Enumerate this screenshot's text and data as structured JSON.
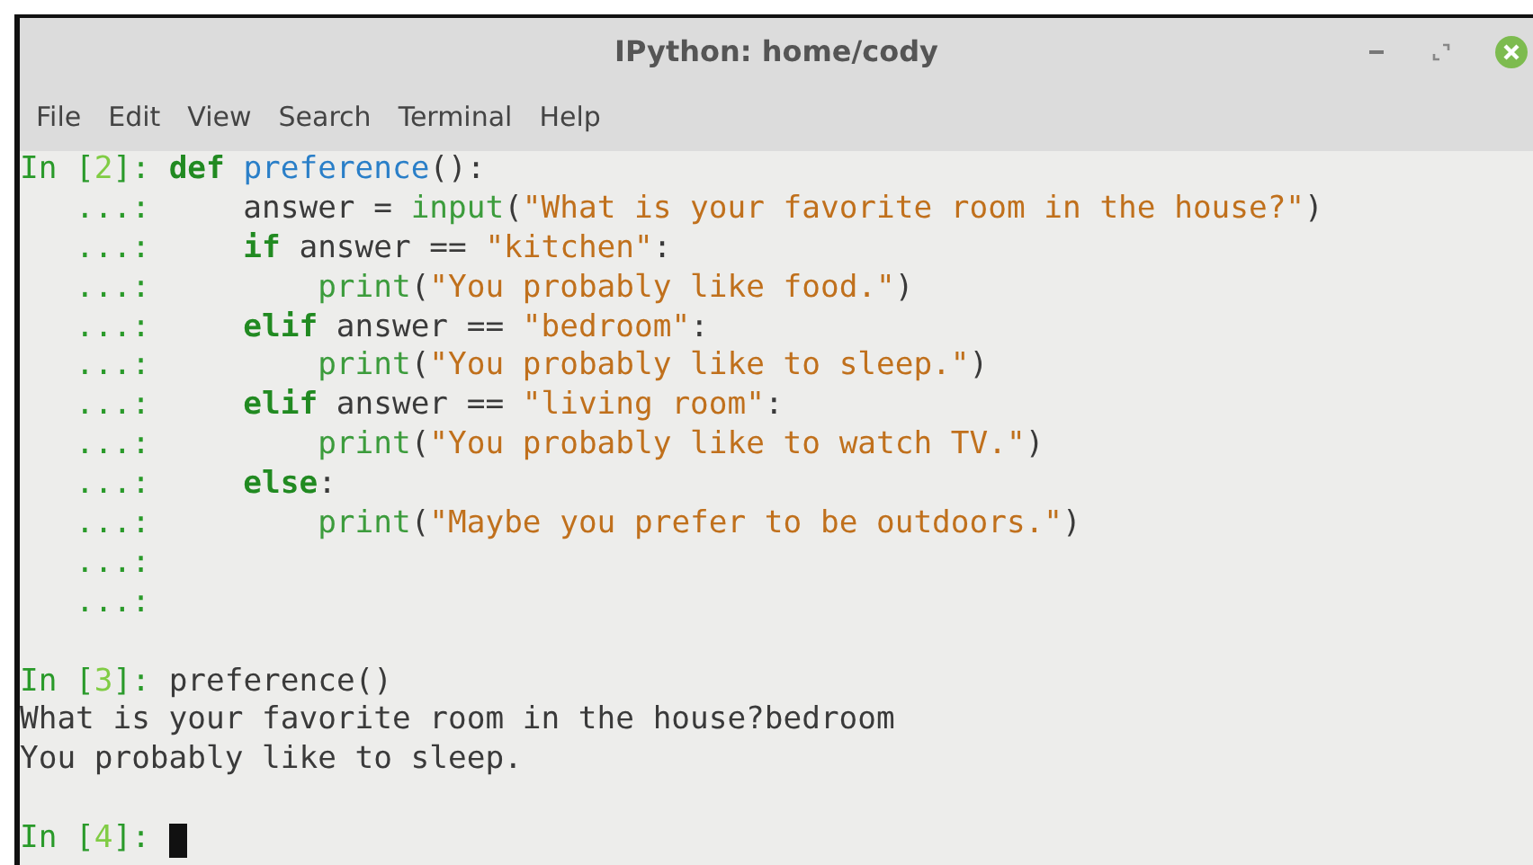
{
  "window": {
    "title": "IPython: home/cody"
  },
  "menu": [
    "File",
    "Edit",
    "View",
    "Search",
    "Terminal",
    "Help"
  ],
  "terminal": {
    "lines": [
      {
        "kind": "input",
        "prompt": [
          {
            "kind": "p",
            "text": "In ["
          },
          {
            "kind": "n",
            "text": "2"
          },
          {
            "kind": "p",
            "text": "]:"
          }
        ],
        "code": [
          {
            "kind": "kw",
            "text": "def"
          },
          {
            "kind": "fn",
            "text": " preference"
          },
          {
            "kind": "x",
            "text": "():"
          }
        ]
      },
      {
        "kind": "input",
        "prompt": [
          {
            "kind": "p",
            "text": "   ...:"
          }
        ],
        "code": [
          {
            "kind": "x",
            "text": "    answer = "
          },
          {
            "kind": "bi",
            "text": "input"
          },
          {
            "kind": "x",
            "text": "("
          },
          {
            "kind": "str",
            "text": "\"What is your favorite room in the house?\""
          },
          {
            "kind": "x",
            "text": ")"
          }
        ]
      },
      {
        "kind": "input",
        "prompt": [
          {
            "kind": "p",
            "text": "   ...:"
          }
        ],
        "code": [
          {
            "kind": "kw",
            "text": "    if"
          },
          {
            "kind": "x",
            "text": " answer == "
          },
          {
            "kind": "str",
            "text": "\"kitchen\""
          },
          {
            "kind": "x",
            "text": ":"
          }
        ]
      },
      {
        "kind": "input",
        "prompt": [
          {
            "kind": "p",
            "text": "   ...:"
          }
        ],
        "code": [
          {
            "kind": "bi",
            "text": "        print"
          },
          {
            "kind": "x",
            "text": "("
          },
          {
            "kind": "str",
            "text": "\"You probably like food.\""
          },
          {
            "kind": "x",
            "text": ")"
          }
        ]
      },
      {
        "kind": "input",
        "prompt": [
          {
            "kind": "p",
            "text": "   ...:"
          }
        ],
        "code": [
          {
            "kind": "kw",
            "text": "    elif"
          },
          {
            "kind": "x",
            "text": " answer == "
          },
          {
            "kind": "str",
            "text": "\"bedroom\""
          },
          {
            "kind": "x",
            "text": ":"
          }
        ]
      },
      {
        "kind": "input",
        "prompt": [
          {
            "kind": "p",
            "text": "   ...:"
          }
        ],
        "code": [
          {
            "kind": "bi",
            "text": "        print"
          },
          {
            "kind": "x",
            "text": "("
          },
          {
            "kind": "str",
            "text": "\"You probably like to sleep.\""
          },
          {
            "kind": "x",
            "text": ")"
          }
        ]
      },
      {
        "kind": "input",
        "prompt": [
          {
            "kind": "p",
            "text": "   ...:"
          }
        ],
        "code": [
          {
            "kind": "kw",
            "text": "    elif"
          },
          {
            "kind": "x",
            "text": " answer == "
          },
          {
            "kind": "str",
            "text": "\"living room\""
          },
          {
            "kind": "x",
            "text": ":"
          }
        ]
      },
      {
        "kind": "input",
        "prompt": [
          {
            "kind": "p",
            "text": "   ...:"
          }
        ],
        "code": [
          {
            "kind": "bi",
            "text": "        print"
          },
          {
            "kind": "x",
            "text": "("
          },
          {
            "kind": "str",
            "text": "\"You probably like to watch TV.\""
          },
          {
            "kind": "x",
            "text": ")"
          }
        ]
      },
      {
        "kind": "input",
        "prompt": [
          {
            "kind": "p",
            "text": "   ...:"
          }
        ],
        "code": [
          {
            "kind": "kw",
            "text": "    else"
          },
          {
            "kind": "x",
            "text": ":"
          }
        ]
      },
      {
        "kind": "input",
        "prompt": [
          {
            "kind": "p",
            "text": "   ...:"
          }
        ],
        "code": [
          {
            "kind": "bi",
            "text": "        print"
          },
          {
            "kind": "x",
            "text": "("
          },
          {
            "kind": "str",
            "text": "\"Maybe you prefer to be outdoors.\""
          },
          {
            "kind": "x",
            "text": ")"
          }
        ]
      },
      {
        "kind": "input",
        "prompt": [
          {
            "kind": "p",
            "text": "   ...:"
          }
        ]
      },
      {
        "kind": "input",
        "prompt": [
          {
            "kind": "p",
            "text": "   ...:"
          }
        ]
      },
      {
        "kind": "blank"
      },
      {
        "kind": "input",
        "prompt": [
          {
            "kind": "p",
            "text": "In ["
          },
          {
            "kind": "n",
            "text": "3"
          },
          {
            "kind": "p",
            "text": "]:"
          }
        ],
        "code": [
          {
            "kind": "x",
            "text": "preference()"
          }
        ]
      },
      {
        "kind": "output",
        "text": "What is your favorite room in the house?bedroom"
      },
      {
        "kind": "output",
        "text": "You probably like to sleep."
      },
      {
        "kind": "blank"
      },
      {
        "kind": "input",
        "prompt": [
          {
            "kind": "p",
            "text": "In ["
          },
          {
            "kind": "n",
            "text": "4"
          },
          {
            "kind": "p",
            "text": "]:"
          }
        ],
        "cursor": true
      }
    ]
  }
}
